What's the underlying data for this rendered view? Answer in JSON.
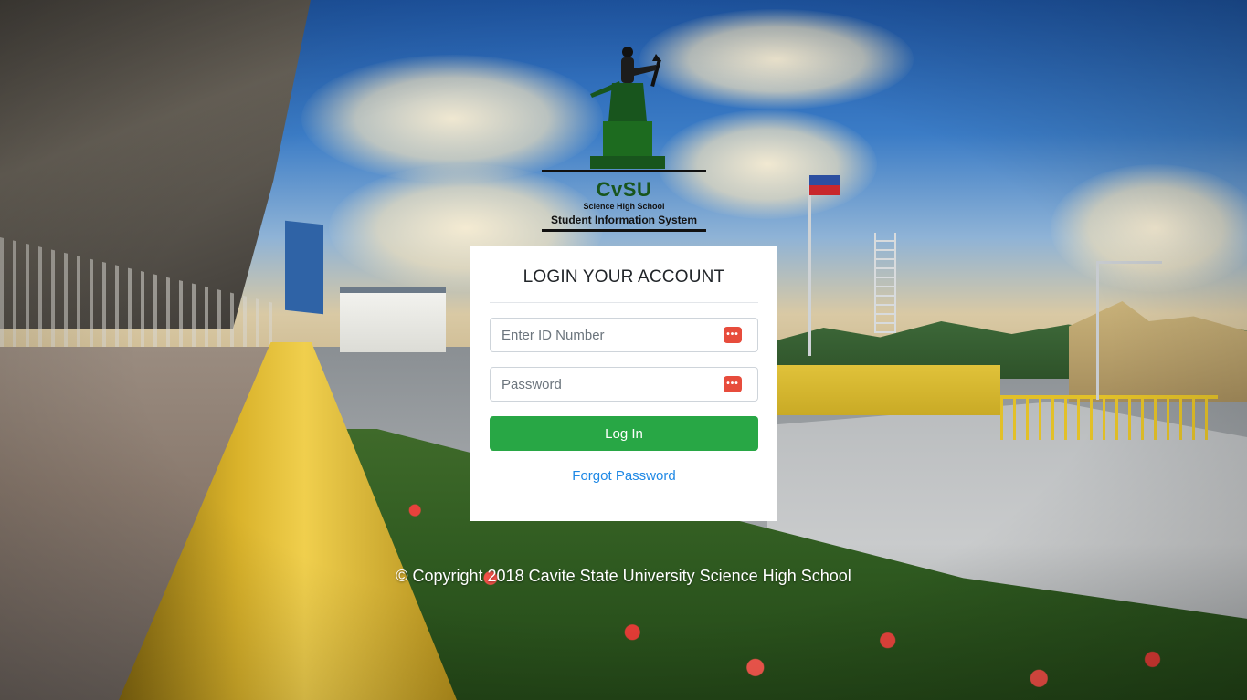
{
  "logo": {
    "brand": "CvSU",
    "subtitle": "Science High School",
    "system_name": "Student Information System"
  },
  "login": {
    "title": "LOGIN YOUR ACCOUNT",
    "id_field": {
      "placeholder": "Enter ID Number",
      "value": "",
      "icon": "password-manager-icon"
    },
    "password_field": {
      "placeholder": "Password",
      "value": "",
      "icon": "password-manager-icon"
    },
    "submit_label": "Log In",
    "forgot_label": "Forgot Password"
  },
  "footer": {
    "copyright": "© Copyright 2018 Cavite State University Science High School"
  },
  "colors": {
    "primary_button": "#28a745",
    "link": "#1e88e5",
    "logo_green": "#18551d",
    "field_icon": "#e74c3c"
  }
}
